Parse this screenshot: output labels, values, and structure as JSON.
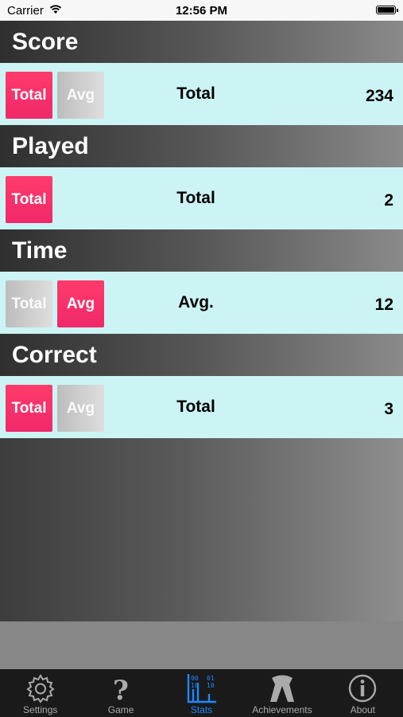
{
  "status_bar": {
    "carrier": "Carrier",
    "time": "12:56 PM"
  },
  "sections": [
    {
      "title": "Score",
      "buttons": [
        {
          "label": "Total",
          "active": true
        },
        {
          "label": "Avg",
          "active": false
        }
      ],
      "mode_label": "Total",
      "value": "234"
    },
    {
      "title": "Played",
      "buttons": [
        {
          "label": "Total",
          "active": true
        }
      ],
      "mode_label": "Total",
      "value": "2"
    },
    {
      "title": "Time",
      "buttons": [
        {
          "label": "Total",
          "active": false
        },
        {
          "label": "Avg",
          "active": true
        }
      ],
      "mode_label": "Avg.",
      "value": "12"
    },
    {
      "title": "Correct",
      "buttons": [
        {
          "label": "Total",
          "active": true
        },
        {
          "label": "Avg",
          "active": false
        }
      ],
      "mode_label": "Total",
      "value": "3"
    }
  ],
  "tab_bar": {
    "selected": "Stats",
    "tabs": [
      {
        "label": "Settings",
        "icon": "gear-icon"
      },
      {
        "label": "Game",
        "icon": "question-mark-icon"
      },
      {
        "label": "Stats",
        "icon": "binary-chart-icon"
      },
      {
        "label": "Achievements",
        "icon": "award-ribbon-icon"
      },
      {
        "label": "About",
        "icon": "info-icon"
      }
    ]
  },
  "colors": {
    "active_button": "#f0286a",
    "row_background": "#ccf4f4",
    "tab_selected": "#1e88ff"
  }
}
